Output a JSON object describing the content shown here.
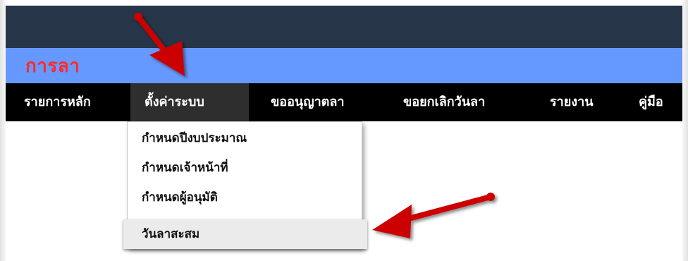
{
  "app": {
    "title": "การลา"
  },
  "menu": {
    "items": [
      {
        "label": "รายการหลัก"
      },
      {
        "label": "ตั้งค่าระบบ"
      },
      {
        "label": "ขออนุญาตลา"
      },
      {
        "label": "ขอยกเลิกวันลา"
      },
      {
        "label": "รายงาน"
      },
      {
        "label": "คู่มือ"
      }
    ],
    "active": "ตั้งค่าระบบ"
  },
  "dropdown": {
    "items": [
      {
        "label": "กำหนดปีงบประมาณ"
      },
      {
        "label": "กำหนดเจ้าหน้าที่"
      },
      {
        "label": "กำหนดผู้อนุมัติ"
      },
      {
        "label": "วันลาสะสม"
      }
    ],
    "highlighted": "วันลาสะสม"
  },
  "colors": {
    "top_bar": "#273548",
    "title_bar": "#6699ff",
    "title_text": "#ff2a2a",
    "menu_bar": "#000000",
    "annotation_arrow": "#cc0000"
  },
  "icons": [
    "annotation-arrow-icon"
  ]
}
